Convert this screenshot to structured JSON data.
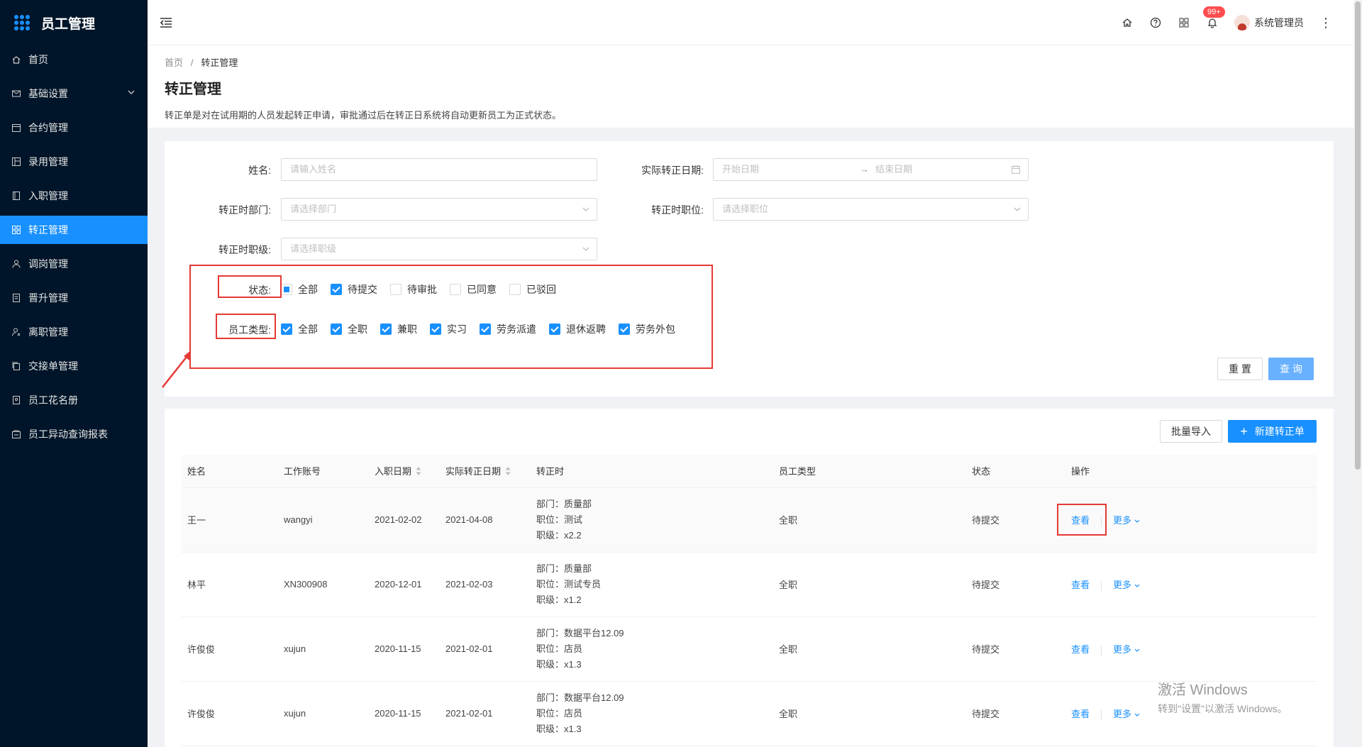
{
  "app": {
    "title": "员工管理"
  },
  "sidebar": {
    "items": [
      {
        "label": "首页",
        "icon": "home-icon"
      },
      {
        "label": "基础设置",
        "icon": "mail-icon"
      },
      {
        "label": "合约管理",
        "icon": "calendar-icon"
      },
      {
        "label": "录用管理",
        "icon": "layout-icon"
      },
      {
        "label": "入职管理",
        "icon": "book-icon"
      },
      {
        "label": "转正管理",
        "icon": "grid-icon"
      },
      {
        "label": "调岗管理",
        "icon": "user-icon"
      },
      {
        "label": "晋升管理",
        "icon": "file-icon"
      },
      {
        "label": "离职管理",
        "icon": "user-leave-icon"
      },
      {
        "label": "交接单管理",
        "icon": "copy-icon"
      },
      {
        "label": "员工花名册",
        "icon": "roster-icon"
      },
      {
        "label": "员工异动查询报表",
        "icon": "report-icon"
      }
    ],
    "active_index": 5
  },
  "header": {
    "badge": "99+",
    "user_name": "系统管理员"
  },
  "page": {
    "breadcrumb": [
      "首页",
      "转正管理"
    ],
    "title": "转正管理",
    "description": "转正单是对在试用期的人员发起转正申请，审批通过后在转正日系统将自动更新员工为正式状态。"
  },
  "filters": {
    "name_label": "姓名:",
    "name_placeholder": "请输入姓名",
    "date_label": "实际转正日期:",
    "date_start_placeholder": "开始日期",
    "date_end_placeholder": "结束日期",
    "dept_label": "转正时部门:",
    "dept_placeholder": "请选择部门",
    "position_label": "转正时职位:",
    "position_placeholder": "请选择职位",
    "level_label": "转正时职级:",
    "level_placeholder": "请选择职级",
    "status_label": "状态:",
    "status_options": [
      {
        "label": "全部",
        "state": "indeterminate"
      },
      {
        "label": "待提交",
        "state": "checked"
      },
      {
        "label": "待审批",
        "state": "unchecked"
      },
      {
        "label": "已同意",
        "state": "unchecked"
      },
      {
        "label": "已驳回",
        "state": "unchecked"
      }
    ],
    "type_label": "员工类型:",
    "type_options": [
      {
        "label": "全部",
        "state": "checked"
      },
      {
        "label": "全职",
        "state": "checked"
      },
      {
        "label": "兼职",
        "state": "checked"
      },
      {
        "label": "实习",
        "state": "checked"
      },
      {
        "label": "劳务派遣",
        "state": "checked"
      },
      {
        "label": "退休返聘",
        "state": "checked"
      },
      {
        "label": "劳务外包",
        "state": "checked"
      }
    ],
    "reset_label": "重 置",
    "search_label": "查 询"
  },
  "toolbar": {
    "import_label": "批量导入",
    "new_label": "新建转正单"
  },
  "table": {
    "columns": [
      "姓名",
      "工作账号",
      "入职日期",
      "实际转正日期",
      "转正时",
      "员工类型",
      "状态",
      "操作"
    ],
    "rows": [
      {
        "name": "王一",
        "account": "wangyi",
        "join_date": "2021-02-02",
        "confirm_date": "2021-04-08",
        "dept": "部门：质量部",
        "position": "职位：测试",
        "level": "职级：x2.2",
        "type": "全职",
        "status": "待提交",
        "view": "查看",
        "more": "更多"
      },
      {
        "name": "林平",
        "account": "XN300908",
        "join_date": "2020-12-01",
        "confirm_date": "2021-02-03",
        "dept": "部门：质量部",
        "position": "职位：测试专员",
        "level": "职级：x1.2",
        "type": "全职",
        "status": "待提交",
        "view": "查看",
        "more": "更多"
      },
      {
        "name": "许俊俊",
        "account": "xujun",
        "join_date": "2020-11-15",
        "confirm_date": "2021-02-01",
        "dept": "部门：数据平台12.09",
        "position": "职位：店员",
        "level": "职级：x1.3",
        "type": "全职",
        "status": "待提交",
        "view": "查看",
        "more": "更多"
      },
      {
        "name": "许俊俊",
        "account": "xujun",
        "join_date": "2020-11-15",
        "confirm_date": "2021-02-01",
        "dept": "部门：数据平台12.09",
        "position": "职位：店员",
        "level": "职级：x1.3",
        "type": "全职",
        "status": "待提交",
        "view": "查看",
        "more": "更多"
      }
    ]
  },
  "watermark": {
    "line1": "激活 Windows",
    "line2": "转到\"设置\"以激活 Windows。"
  },
  "colors": {
    "sidebar_bg": "#001529",
    "primary": "#1890ff",
    "annotation_red": "#e53935"
  }
}
